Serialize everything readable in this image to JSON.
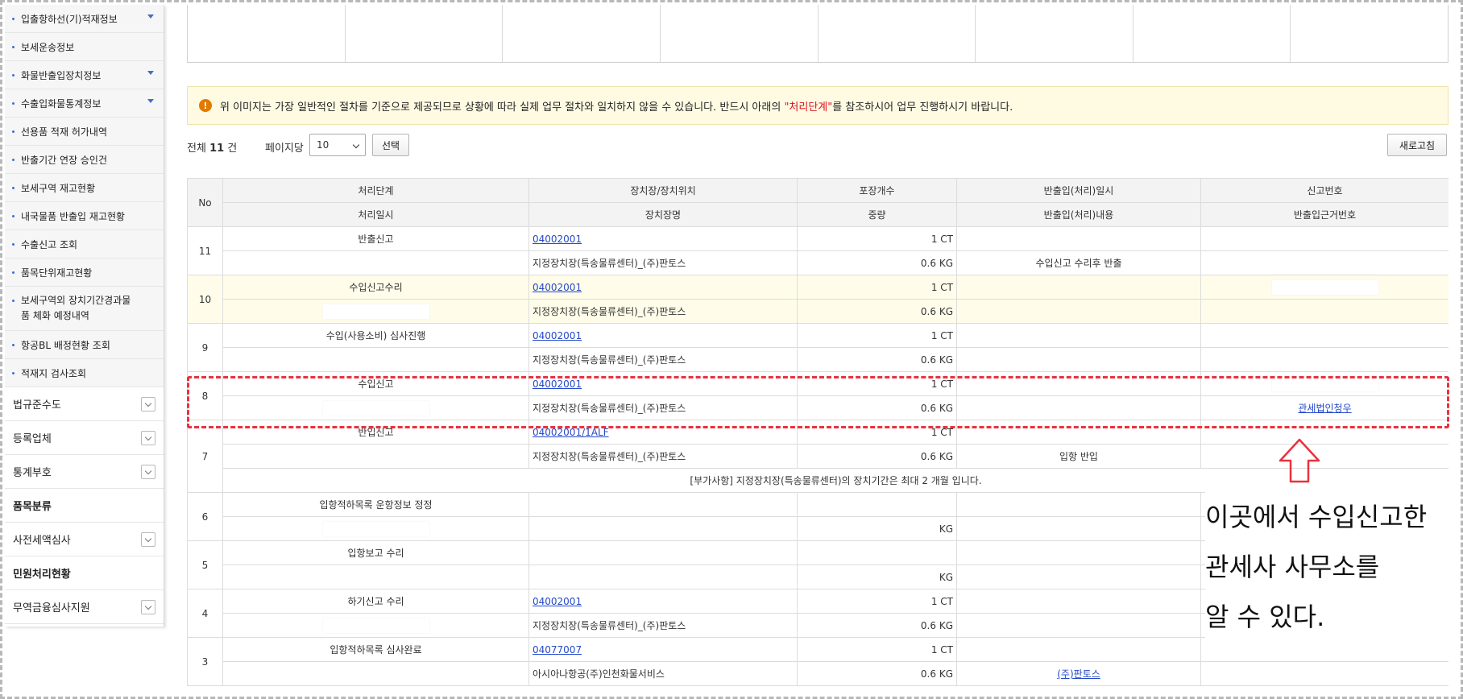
{
  "sidebar": {
    "sub_items": [
      {
        "label": "입출항하선(기)적재정보",
        "caret": true
      },
      {
        "label": "보세운송정보",
        "caret": false
      },
      {
        "label": "화물반출입장치정보",
        "caret": true
      },
      {
        "label": "수출입화물통계정보",
        "caret": true
      },
      {
        "label": "선용품 적재 허가내역",
        "caret": false
      },
      {
        "label": "반출기간 연장 승인건",
        "caret": false
      },
      {
        "label": "보세구역 재고현황",
        "caret": false
      },
      {
        "label": "내국물품 반출입 재고현황",
        "caret": false
      },
      {
        "label": "수출신고 조회",
        "caret": false
      },
      {
        "label": "품목단위재고현황",
        "caret": false
      },
      {
        "label_line1": "보세구역외 장치기간경과물",
        "label_line2": "품 체화 예정내역",
        "caret": false
      },
      {
        "label": "항공BL 배정현황 조회",
        "caret": false
      },
      {
        "label": "적재지 검사조회",
        "caret": false
      }
    ],
    "main_items": [
      {
        "label": "법규준수도",
        "toggle": true
      },
      {
        "label": "등록업체",
        "toggle": true
      },
      {
        "label": "통계부호",
        "toggle": true
      },
      {
        "label": "품목분류",
        "toggle": false
      },
      {
        "label": "사전세액심사",
        "toggle": true
      },
      {
        "label": "민원처리현황",
        "toggle": false
      },
      {
        "label": "무역금융심사지원",
        "toggle": true
      }
    ]
  },
  "icon_strip": [
    "clipboard-pen-icon",
    "stamp-document-icon",
    "document-pen-icon",
    "printer-documents-icon",
    "cargo-truck-icon",
    "book-pen-icon",
    "settings-document-icon",
    "certificate-seal-icon"
  ],
  "notice": {
    "before": "위 이미지는 가장 일반적인 절차를 기준으로 제공되므로 상황에 따라 실제 업무 절차와 일치하지 않을 수 있습니다. 반드시 아래의 ",
    "highlight": "\"처리단계\"",
    "after": "를 참조하시어 업무 진행하시기 바랍니다."
  },
  "toolbar": {
    "total_prefix": "전체",
    "total_count": "11",
    "total_suffix": "건",
    "per_page_label": "페이지당",
    "per_page_value": "10",
    "select_label": "선택",
    "refresh_label": "새로고침"
  },
  "table": {
    "headers_row1": [
      "No",
      "처리단계",
      "장치장/장치위치",
      "포장개수",
      "반출입(처리)일시",
      "신고번호"
    ],
    "headers_row2": [
      "처리일시",
      "장치장명",
      "중량",
      "반출입(처리)내용",
      "반출입근거번호"
    ],
    "records": [
      {
        "no": "11",
        "stage": "반출신고",
        "date_masked": false,
        "loc": "04002001",
        "loc_link": true,
        "pkg": "1 CT",
        "io_time": "",
        "report_no": "",
        "report_masked": false,
        "warehouse": "지정장치장(특송물류센터)_(주)판토스",
        "weight": "0.6 KG",
        "io_content": "수입신고 수리후 반출",
        "basis": "",
        "basis_link": false,
        "yellow": false
      },
      {
        "no": "10",
        "stage": "수입신고수리",
        "date_masked": true,
        "loc": "04002001",
        "loc_link": true,
        "pkg": "1 CT",
        "io_time": "",
        "report_no": "",
        "report_masked": true,
        "warehouse": "지정장치장(특송물류센터)_(주)판토스",
        "weight": "0.6 KG",
        "io_content": "",
        "basis": "",
        "basis_link": false,
        "yellow": true
      },
      {
        "no": "9",
        "stage": "수입(사용소비) 심사진행",
        "date_masked": false,
        "loc": "04002001",
        "loc_link": true,
        "pkg": "1 CT",
        "io_time": "",
        "report_no": "",
        "report_masked": false,
        "warehouse": "지정장치장(특송물류센터)_(주)판토스",
        "weight": "0.6 KG",
        "io_content": "",
        "basis": "",
        "basis_link": false,
        "yellow": false
      },
      {
        "no": "8",
        "stage": "수입신고",
        "date_masked": true,
        "loc": "04002001",
        "loc_link": true,
        "pkg": "1 CT",
        "io_time": "",
        "report_no": "",
        "report_masked": true,
        "warehouse": "지정장치장(특송물류센터)_(주)판토스",
        "weight": "0.6 KG",
        "io_content": "",
        "basis": "관세법인청우",
        "basis_link": true,
        "yellow": false
      },
      {
        "no": "7",
        "stage": "반입신고",
        "date_masked": false,
        "loc": "04002001/1ALF",
        "loc_link": true,
        "pkg": "1 CT",
        "io_time": "",
        "report_no": "",
        "report_masked": false,
        "warehouse": "지정장치장(특송물류센터)_(주)판토스",
        "weight": "0.6 KG",
        "io_content": "입항 반입",
        "basis": "",
        "basis_link": false,
        "yellow": false,
        "note": "[부가사항] 지정장치장(특송물류센터)의 장치기간은 최대 2 개월 입니다."
      },
      {
        "no": "6",
        "stage": "입항적하목록 운항정보 정정",
        "date_masked": true,
        "loc": "",
        "loc_link": false,
        "pkg": "",
        "io_time": "",
        "report_no": "",
        "report_masked": false,
        "warehouse": "",
        "weight": "KG",
        "io_content": "",
        "basis": "",
        "basis_link": false,
        "yellow": false
      },
      {
        "no": "5",
        "stage": "입항보고 수리",
        "date_masked": false,
        "loc": "",
        "loc_link": false,
        "pkg": "",
        "io_time": "",
        "report_no": "",
        "report_masked": false,
        "warehouse": "",
        "weight": "KG",
        "io_content": "",
        "basis": "",
        "basis_link": false,
        "yellow": false
      },
      {
        "no": "4",
        "stage": "하기신고 수리",
        "date_masked": true,
        "loc": "04002001",
        "loc_link": true,
        "pkg": "1 CT",
        "io_time": "",
        "report_no": "",
        "report_masked": false,
        "warehouse": "지정장치장(특송물류센터)_(주)판토스",
        "weight": "0.6 KG",
        "io_content": "",
        "basis": "",
        "basis_link": false,
        "yellow": false
      },
      {
        "no": "3",
        "stage": "입항적하목록 심사완료",
        "date_masked": false,
        "loc": "04077007",
        "loc_link": true,
        "pkg": "1 CT",
        "io_time": "",
        "report_no": "",
        "report_masked": false,
        "warehouse": "아시아나항공(주)인천화물서비스",
        "weight": "0.6 KG",
        "io_content": "(주)판토스",
        "io_link": true,
        "basis": "",
        "basis_link": false,
        "yellow": false
      }
    ]
  },
  "annotation": {
    "line1": "이곳에서 수입신고한",
    "line2": "관세사 사무소를",
    "line3": "알 수 있다."
  },
  "colors": {
    "highlight": "#e8323f",
    "link": "#2449c9",
    "notice_bg": "#fffbe3",
    "notice_accent": "#d8121e"
  }
}
